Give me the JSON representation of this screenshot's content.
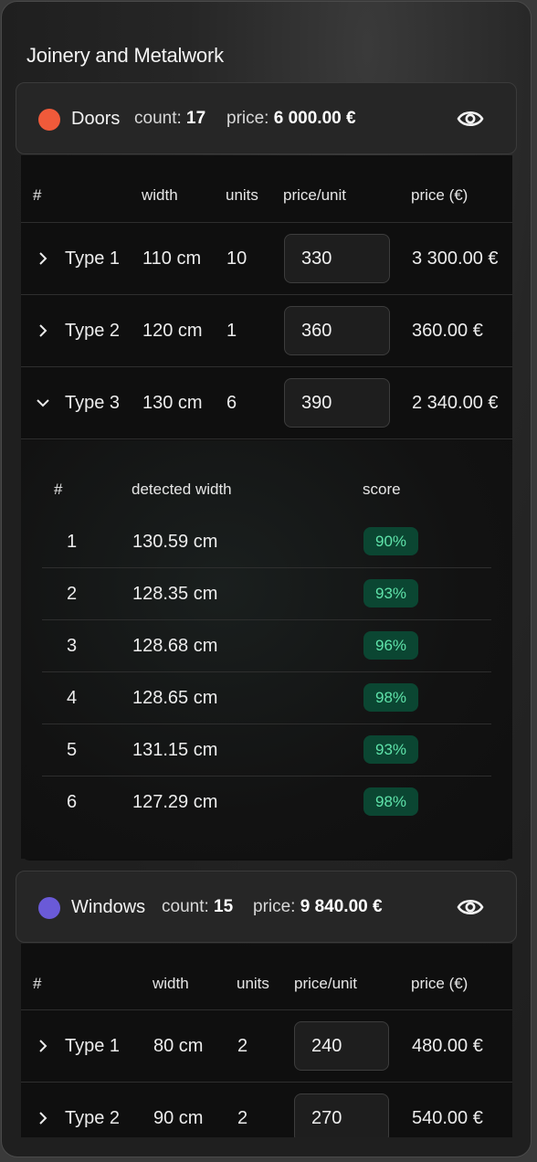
{
  "title": "Joinery and Metalwork",
  "groups": {
    "doors": {
      "name": "Doors",
      "color": "#f05a3a",
      "count_label": "count:",
      "count": "17",
      "price_label": "price:",
      "price": "6 000.00 €",
      "columns": [
        "#",
        "width",
        "units",
        "price/unit",
        "price (€)"
      ],
      "rows": [
        {
          "type": "Type 1",
          "width": "110 cm",
          "units": "10",
          "price_unit": "330",
          "price": "3 300.00 €",
          "expanded": false
        },
        {
          "type": "Type 2",
          "width": "120 cm",
          "units": "1",
          "price_unit": "360",
          "price": "360.00 €",
          "expanded": false
        },
        {
          "type": "Type 3",
          "width": "130 cm",
          "units": "6",
          "price_unit": "390",
          "price": "2 340.00 €",
          "expanded": true
        }
      ],
      "detail": {
        "columns": [
          "#",
          "detected width",
          "score"
        ],
        "rows": [
          {
            "n": "1",
            "width": "130.59 cm",
            "score": "90%"
          },
          {
            "n": "2",
            "width": "128.35 cm",
            "score": "93%"
          },
          {
            "n": "3",
            "width": "128.68 cm",
            "score": "96%"
          },
          {
            "n": "4",
            "width": "128.65 cm",
            "score": "98%"
          },
          {
            "n": "5",
            "width": "131.15 cm",
            "score": "93%"
          },
          {
            "n": "6",
            "width": "127.29 cm",
            "score": "98%"
          }
        ]
      }
    },
    "windows": {
      "name": "Windows",
      "color": "#6a5ad8",
      "count_label": "count:",
      "count": "15",
      "price_label": "price:",
      "price": "9 840.00 €",
      "columns": [
        "#",
        "width",
        "units",
        "price/unit",
        "price (€)"
      ],
      "rows": [
        {
          "type": "Type 1",
          "width": "80 cm",
          "units": "2",
          "price_unit": "240",
          "price": "480.00 €",
          "expanded": false
        },
        {
          "type": "Type 2",
          "width": "90 cm",
          "units": "2",
          "price_unit": "270",
          "price": "540.00 €",
          "expanded": false
        }
      ]
    }
  }
}
